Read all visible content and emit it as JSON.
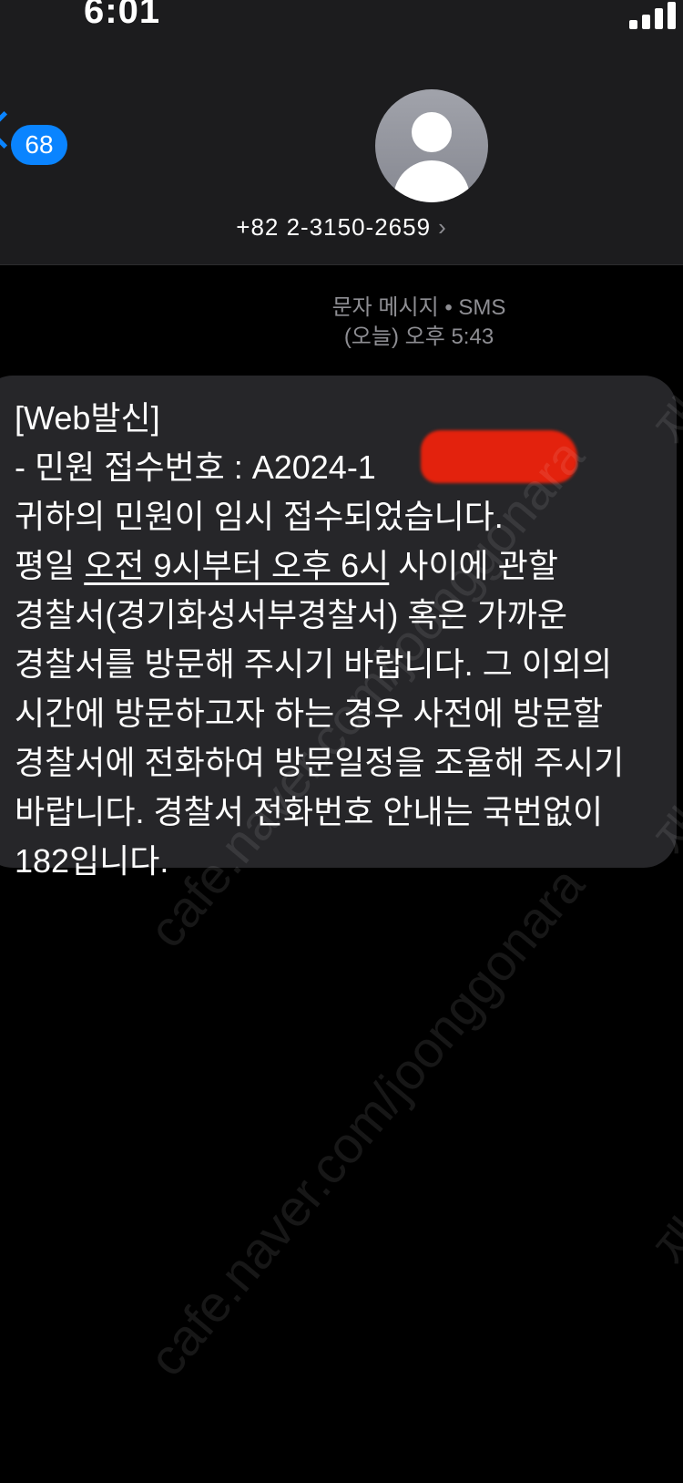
{
  "status_bar": {
    "time": "6:01"
  },
  "nav": {
    "unread_count": "68"
  },
  "contact": {
    "number": "+82 2-3150-2659",
    "chevron": "›"
  },
  "message_meta": {
    "type_line": "문자 메시지 • SMS",
    "time_line": "(오늘) 오후 5:43"
  },
  "message": {
    "line1": "[Web발신]",
    "line2": "- 민원 접수번호 : A2024-1",
    "line3": "귀하의 민원이 임시 접수되었습니다.",
    "line4_pre": "평일 ",
    "line4_under": "오전 9시부터 오후 6시",
    "line4_post": " 사이에 관할",
    "line5": "경찰서(경기화성서부경찰서) 혹은 가까운",
    "line6": "경찰서를 방문해 주시기 바랍니다. 그 이외의",
    "line7": "시간에 방문하고자 하는 경우 사전에 방문할",
    "line8": "경찰서에 전화하여 방문일정을 조율해 주시기",
    "line9": "바랍니다. 경찰서 전화번호 안내는 국번없이",
    "line10": "182입니다."
  },
  "watermark": {
    "text": "cafe.naver.com/joonggonara",
    "text2": "재"
  },
  "colors": {
    "accent": "#0a84ff",
    "bubble": "#262629",
    "redaction": "#e3220d"
  }
}
